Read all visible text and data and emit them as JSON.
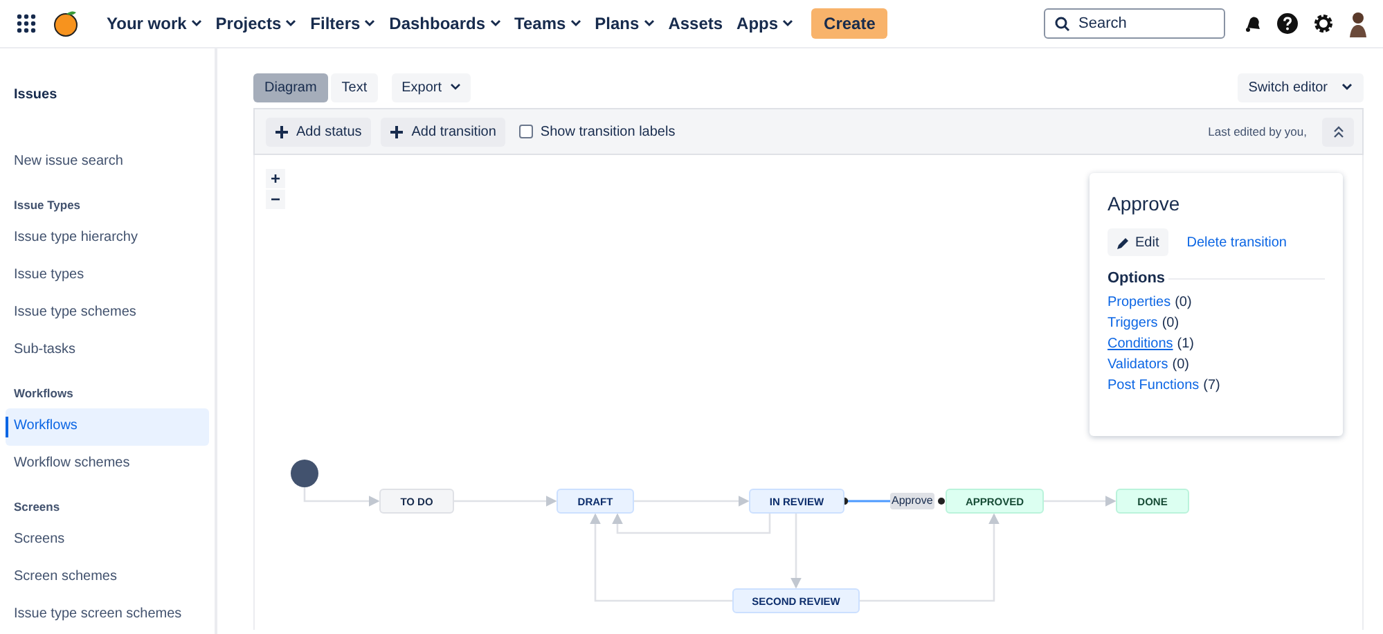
{
  "nav": {
    "items": [
      {
        "label": "Your work",
        "menu": true
      },
      {
        "label": "Projects",
        "menu": true
      },
      {
        "label": "Filters",
        "menu": true
      },
      {
        "label": "Dashboards",
        "menu": true
      },
      {
        "label": "Teams",
        "menu": true
      },
      {
        "label": "Plans",
        "menu": true
      },
      {
        "label": "Assets",
        "menu": false
      },
      {
        "label": "Apps",
        "menu": true
      }
    ],
    "create": "Create",
    "search": {
      "placeholder": "Search"
    }
  },
  "sidebar": {
    "title": "Issues",
    "sections": [
      {
        "items": [
          {
            "label": "New issue search",
            "selected": false
          }
        ]
      },
      {
        "heading": "Issue Types",
        "items": [
          {
            "label": "Issue type hierarchy",
            "selected": false
          },
          {
            "label": "Issue types",
            "selected": false
          },
          {
            "label": "Issue type schemes",
            "selected": false
          },
          {
            "label": "Sub-tasks",
            "selected": false
          }
        ]
      },
      {
        "heading": "Workflows",
        "items": [
          {
            "label": "Workflows",
            "selected": true
          },
          {
            "label": "Workflow schemes",
            "selected": false
          }
        ]
      },
      {
        "heading": "Screens",
        "items": [
          {
            "label": "Screens",
            "selected": false
          },
          {
            "label": "Screen schemes",
            "selected": false
          },
          {
            "label": "Issue type screen schemes",
            "selected": false
          }
        ]
      }
    ]
  },
  "view_tabs": [
    {
      "label": "Diagram",
      "selected": true
    },
    {
      "label": "Text",
      "selected": false
    }
  ],
  "export": "Export",
  "switch_editor": "Switch editor",
  "toolbar": {
    "add_status": "Add status",
    "add_transition": "Add transition",
    "show_labels": {
      "label": "Show transition labels",
      "checked": false
    },
    "last_edited": "Last edited by you,"
  },
  "zoom": {
    "in": "+",
    "out": "−"
  },
  "statuses": [
    {
      "label": "TO DO",
      "kind": "todo"
    },
    {
      "label": "DRAFT",
      "kind": "progress"
    },
    {
      "label": "IN REVIEW",
      "kind": "progress"
    },
    {
      "label": "APPROVED",
      "kind": "done"
    },
    {
      "label": "DONE",
      "kind": "done"
    },
    {
      "label": "SECOND REVIEW",
      "kind": "progress"
    }
  ],
  "selected_transition": {
    "label": "Approve"
  },
  "popup": {
    "title": "Approve",
    "edit": "Edit",
    "delete": "Delete transition",
    "options_heading": "Options",
    "options": [
      {
        "link": "Properties",
        "count": "(0)",
        "kind": "plain"
      },
      {
        "link": "Triggers",
        "count": "(0)",
        "kind": "plain"
      },
      {
        "link": "Conditions",
        "count": "(1)",
        "kind": "underlined"
      },
      {
        "link": "Validators",
        "count": "(0)",
        "kind": "plain"
      },
      {
        "link": "Post Functions",
        "count": "(7)",
        "kind": "plain"
      }
    ]
  }
}
